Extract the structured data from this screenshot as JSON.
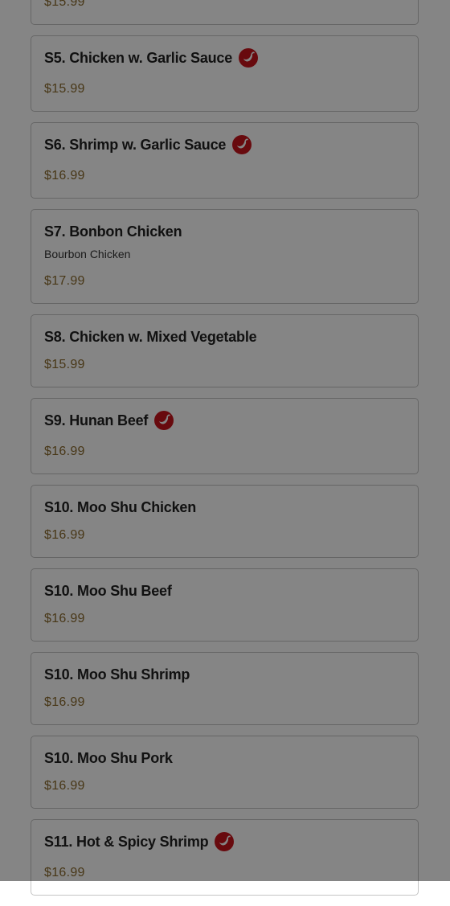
{
  "menu": {
    "items": [
      {
        "name": "",
        "description": "",
        "price": "$15.99",
        "spicy": false
      },
      {
        "name": "S5. Chicken w. Garlic Sauce",
        "description": "",
        "price": "$15.99",
        "spicy": true
      },
      {
        "name": "S6. Shrimp w. Garlic Sauce",
        "description": "",
        "price": "$16.99",
        "spicy": true
      },
      {
        "name": "S7. Bonbon Chicken",
        "description": "Bourbon Chicken",
        "price": "$17.99",
        "spicy": false
      },
      {
        "name": "S8. Chicken w. Mixed Vegetable",
        "description": "",
        "price": "$15.99",
        "spicy": false
      },
      {
        "name": "S9. Hunan Beef",
        "description": "",
        "price": "$16.99",
        "spicy": true
      },
      {
        "name": "S10. Moo Shu Chicken",
        "description": "",
        "price": "$16.99",
        "spicy": false
      },
      {
        "name": "S10. Moo Shu Beef",
        "description": "",
        "price": "$16.99",
        "spicy": false
      },
      {
        "name": "S10. Moo Shu Shrimp",
        "description": "",
        "price": "$16.99",
        "spicy": false
      },
      {
        "name": "S10. Moo Shu Pork",
        "description": "",
        "price": "$16.99",
        "spicy": false
      },
      {
        "name": "S11. Hot & Spicy Shrimp",
        "description": "",
        "price": "$16.99",
        "spicy": true
      }
    ]
  },
  "colors": {
    "price": "#8a6a2c",
    "spicy_badge": "#c8151b",
    "overlay": "rgba(0,0,0,0.48)"
  },
  "icons": {
    "spicy": "chili-pepper-icon"
  }
}
